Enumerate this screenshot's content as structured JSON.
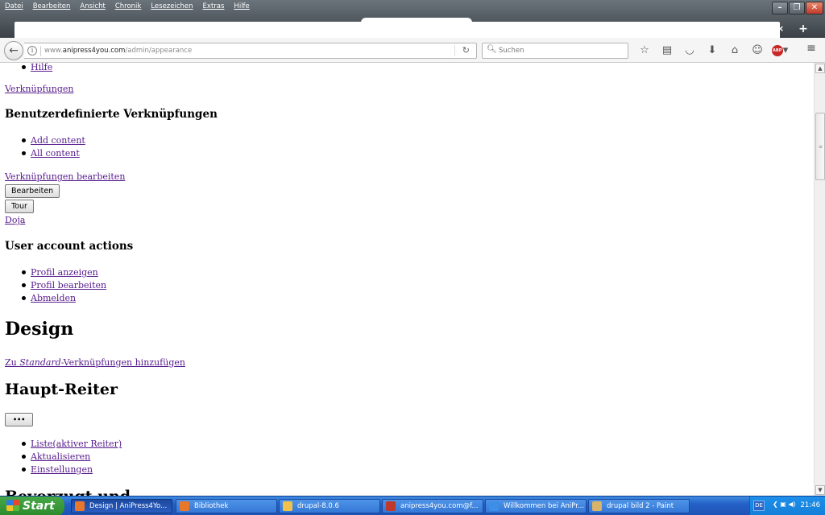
{
  "menubar": {
    "items": [
      "Datei",
      "Bearbeiten",
      "Ansicht",
      "Chronik",
      "Lesezeichen",
      "Extras",
      "Hilfe"
    ]
  },
  "window_controls": {
    "minimize": "–",
    "restore": "❐",
    "close": "✕"
  },
  "tabs": {
    "close": "×",
    "new": "+"
  },
  "navbar": {
    "back": "←",
    "url_prefix": "www.",
    "url_domain": "anipress4you.com",
    "url_path": "/admin/appearance",
    "reload": "↻",
    "search_placeholder": "Suchen",
    "toolbar_icons": [
      "bookmark-star-icon",
      "reading-list-icon",
      "pocket-icon",
      "download-icon",
      "home-icon",
      "chat-icon",
      "abp-icon"
    ],
    "abp_label": "ABP",
    "menu": "≡"
  },
  "page": {
    "top_link": "Hilfe",
    "shortcuts_link": "Verknüpfungen",
    "custom_shortcuts_heading": "Benutzerdefinierte Verknüpfungen",
    "custom_shortcuts": [
      "Add content",
      "All content"
    ],
    "edit_shortcuts_link": "Verknüpfungen bearbeiten",
    "edit_button": "Bearbeiten",
    "tour_button": "Tour",
    "user_link": "Doja",
    "user_actions_heading": "User account actions",
    "user_actions": [
      "Profil anzeigen",
      "Profil bearbeiten",
      "Abmelden"
    ],
    "design_heading": "Design",
    "add_std_prefix": "Zu ",
    "add_std_em": "Standard",
    "add_std_suffix": "-Verknüpfungen hinzufügen",
    "main_tabs_heading": "Haupt-Reiter",
    "more_button": "•••",
    "main_tabs": [
      "Liste(aktiver Reiter)",
      "Aktualisieren",
      "Einstellungen"
    ],
    "cut_heading": "Bevorzugt und"
  },
  "taskbar": {
    "start": "Start",
    "tasks": [
      "Design | AniPress4Yo...",
      "Bibliothek",
      "drupal-8.0.6",
      "anipress4you.com@f...",
      "Willkommen bei AniPr...",
      "drupal bild 2 - Paint"
    ],
    "task_icon_colors": [
      "#e8772b",
      "#e8772b",
      "#f0c24b",
      "#c0392b",
      "#3c8ee6",
      "#d9b36a"
    ],
    "lang": "DE",
    "clock": "21:46"
  }
}
